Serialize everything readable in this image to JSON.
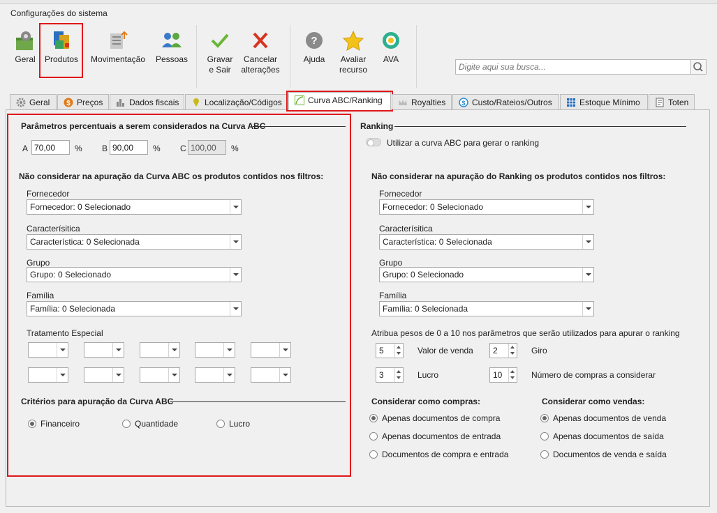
{
  "window": {
    "title": "Configurações do sistema"
  },
  "toolbar": {
    "geral": "Geral",
    "produtos": "Produtos",
    "movimentacao": "Movimentação",
    "pessoas": "Pessoas",
    "gravar_1": "Gravar",
    "gravar_2": "e Sair",
    "cancelar_1": "Cancelar",
    "cancelar_2": "alterações",
    "ajuda": "Ajuda",
    "avaliar_1": "Avaliar",
    "avaliar_2": "recurso",
    "ava": "AVA",
    "search_placeholder": "Digite aqui sua busca..."
  },
  "tabs": [
    "Geral",
    "Preços",
    "Dados fiscais",
    "Localização/Códigos",
    "Curva ABC/Ranking",
    "Royalties",
    "Custo/Rateios/Outros",
    "Estoque Mínimo",
    "Toten"
  ],
  "abc": {
    "params_title": "Parâmetros percentuais a serem considerados na Curva ABC",
    "a_label": "A",
    "a_value": "70,00",
    "b_label": "B",
    "b_value": "90,00",
    "c_label": "C",
    "c_value": "100,00",
    "pct": "%",
    "filters_title": "Não considerar na apuração da Curva ABC os produtos contidos nos filtros:",
    "fornecedor_label": "Fornecedor",
    "fornecedor_value": "Fornecedor: 0 Selecionado",
    "caracteristica_label": "Caracterísitica",
    "caracteristica_value": "Característica: 0 Selecionada",
    "grupo_label": "Grupo",
    "grupo_value": "Grupo: 0 Selecionado",
    "familia_label": "Família",
    "familia_value": "Família: 0 Selecionada",
    "tratamento_label": "Tratamento Especial",
    "criterios_title": "Critérios para apuração da Curva ABC",
    "criterios": [
      "Financeiro",
      "Quantidade",
      "Lucro"
    ],
    "criterio_selected": "Financeiro"
  },
  "ranking": {
    "title": "Ranking",
    "toggle_label": "Utilizar a curva ABC para gerar o ranking",
    "filters_title": "Não considerar na apuração do Ranking os produtos contidos nos filtros:",
    "fornecedor_label": "Fornecedor",
    "fornecedor_value": "Fornecedor: 0 Selecionado",
    "caracteristica_label": "Caracterísitica",
    "caracteristica_value": "Característica: 0 Selecionada",
    "grupo_label": "Grupo",
    "grupo_value": "Grupo: 0 Selecionado",
    "familia_label": "Família",
    "familia_value": "Família: 0 Selecionada",
    "pesos_label": "Atribua pesos de 0 a 10 nos parâmetros que serão utilizados para apurar o ranking",
    "valor_venda_value": "5",
    "valor_venda_label": "Valor de venda",
    "giro_value": "2",
    "giro_label": "Giro",
    "lucro_value": "3",
    "lucro_label": "Lucro",
    "num_compras_value": "10",
    "num_compras_label": "Número de compras a considerar",
    "compras_title": "Considerar como compras:",
    "compras": [
      "Apenas documentos de compra",
      "Apenas documentos de entrada",
      "Documentos de compra e entrada"
    ],
    "vendas_title": "Considerar como vendas:",
    "vendas": [
      "Apenas documentos de venda",
      "Apenas documentos de saída",
      "Documentos de venda e saída"
    ]
  },
  "colors": {
    "highlight": "#e0161a",
    "panel": "#f0f0f0"
  }
}
